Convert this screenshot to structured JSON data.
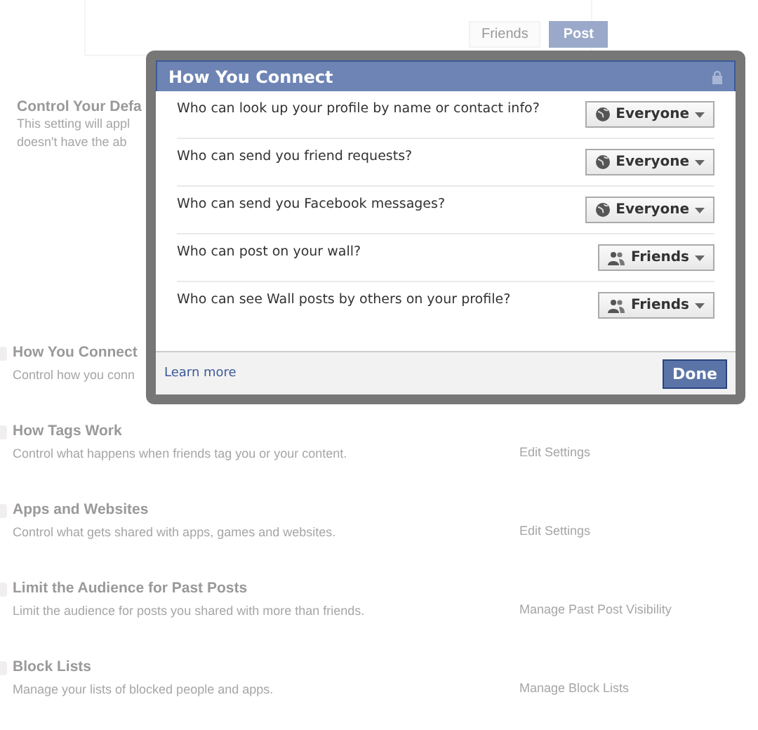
{
  "composer": {
    "audience_button": "Friends",
    "post_button": "Post"
  },
  "default_section": {
    "title": "Control Your Defa",
    "lines": [
      "This setting will appl",
      "doesn't have the ab"
    ]
  },
  "sections": [
    {
      "title": "How You Connect",
      "description": "Control how you conn"
    },
    {
      "title": "How Tags Work",
      "description": "Control what happens when friends tag you or your content.",
      "link": "Edit Settings"
    },
    {
      "title": "Apps and Websites",
      "description": "Control what gets shared with apps, games and websites.",
      "link": "Edit Settings"
    },
    {
      "title": "Limit the Audience for Past Posts",
      "description": "Limit the audience for posts you shared with more than friends.",
      "link": "Manage Past Post Visibility"
    },
    {
      "title": "Block Lists",
      "description": "Manage your lists of blocked people and apps.",
      "link": "Manage Block Lists"
    }
  ],
  "dialog": {
    "title": "How You Connect",
    "settings": [
      {
        "question": "Who can look up your profile by name or contact info?",
        "audience": {
          "kind": "everyone",
          "label": "Everyone"
        }
      },
      {
        "question": "Who can send you friend requests?",
        "audience": {
          "kind": "everyone",
          "label": "Everyone"
        }
      },
      {
        "question": "Who can send you Facebook messages?",
        "audience": {
          "kind": "everyone",
          "label": "Everyone"
        }
      },
      {
        "question": "Who can post on your wall?",
        "audience": {
          "kind": "friends",
          "label": "Friends"
        }
      },
      {
        "question": "Who can see Wall posts by others on your profile?",
        "audience": {
          "kind": "friends",
          "label": "Friends"
        }
      }
    ],
    "footer_link": "Learn more",
    "done_button": "Done"
  }
}
